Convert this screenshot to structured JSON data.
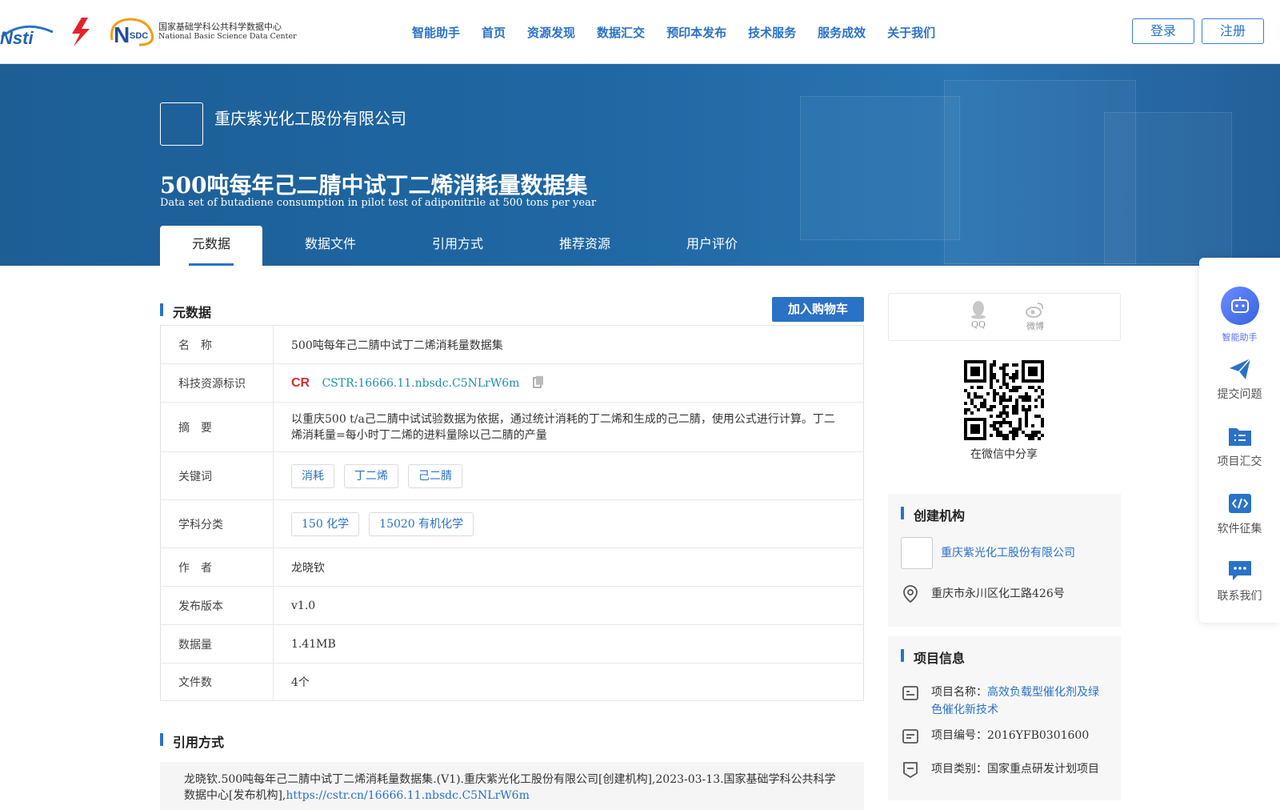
{
  "header": {
    "logo_nstl": "Nsti",
    "logo_nsdc_mark": "NSDC",
    "logo_nsdc_cn": "国家基础学科公共科学数据中心",
    "logo_nsdc_en": "National Basic Science Data Center",
    "nav": [
      "智能助手",
      "首页",
      "资源发现",
      "数据汇交",
      "预印本发布",
      "技术服务",
      "服务成效",
      "关于我们"
    ],
    "login": "登录",
    "register": "注册"
  },
  "banner": {
    "org_name": "重庆紫光化工股份有限公司",
    "title_zh": "500吨每年己二腈中试丁二烯消耗量数据集",
    "title_en": "Data set of butadiene consumption in pilot test of adiponitrile at 500 tons per year",
    "tabs": [
      "元数据",
      "数据文件",
      "引用方式",
      "推荐资源",
      "用户评价"
    ]
  },
  "metadata": {
    "section_title": "元数据",
    "cart_button": "加入购物车",
    "rows": {
      "name": {
        "k": "名　称",
        "v": "500吨每年己二腈中试丁二烯消耗量数据集"
      },
      "cstr": {
        "k": "科技资源标识",
        "v": "CSTR:16666.11.nbsdc.C5NLrW6m"
      },
      "abstract": {
        "k": "摘　要",
        "v": "以重庆500 t/a己二腈中试试验数据为依据，通过统计消耗的丁二烯和生成的己二腈，使用公式进行计算。丁二烯消耗量=每小时丁二烯的进料量除以己二腈的产量"
      },
      "keywords": {
        "k": "关键词",
        "tags": [
          "消耗",
          "丁二烯",
          "己二腈"
        ]
      },
      "subject": {
        "k": "学科分类",
        "tags": [
          "150 化学",
          "15020 有机化学"
        ]
      },
      "author": {
        "k": "作　者",
        "v": "龙晓钦"
      },
      "version": {
        "k": "发布版本",
        "v": "v1.0"
      },
      "size": {
        "k": "数据量",
        "v": "1.41MB"
      },
      "files": {
        "k": "文件数",
        "v": "4个"
      }
    }
  },
  "citation": {
    "section_title": "引用方式",
    "text": "龙晓钦.500吨每年己二腈中试丁二烯消耗量数据集.(V1).重庆紫光化工股份有限公司[创建机构],2023-03-13.国家基础学科公共科学数据中心[发布机构],",
    "link": "https://cstr.cn/16666.11.nbsdc.C5NLrW6m"
  },
  "share": {
    "qq": "QQ",
    "weibo": "微博",
    "wechat_caption": "在微信中分享"
  },
  "creator": {
    "section_title": "创建机构",
    "org_name": "重庆紫光化工股份有限公司",
    "address": "重庆市永川区化工路426号"
  },
  "project": {
    "section_title": "项目信息",
    "name_label": "项目名称：",
    "name_value": "高效负载型催化剂及绿色催化新技术",
    "code_label": "项目编号：",
    "code_value": "2016YFB0301600",
    "type_label": "项目类别：",
    "type_value": "国家重点研发计划项目"
  },
  "side_widget": {
    "assistant": "智能助手",
    "submit": "提交问题",
    "collect": "项目汇交",
    "software": "软件征集",
    "contact": "联系我们"
  },
  "colors": {
    "accent": "#2a72c6",
    "banner": "#1f67a3"
  }
}
